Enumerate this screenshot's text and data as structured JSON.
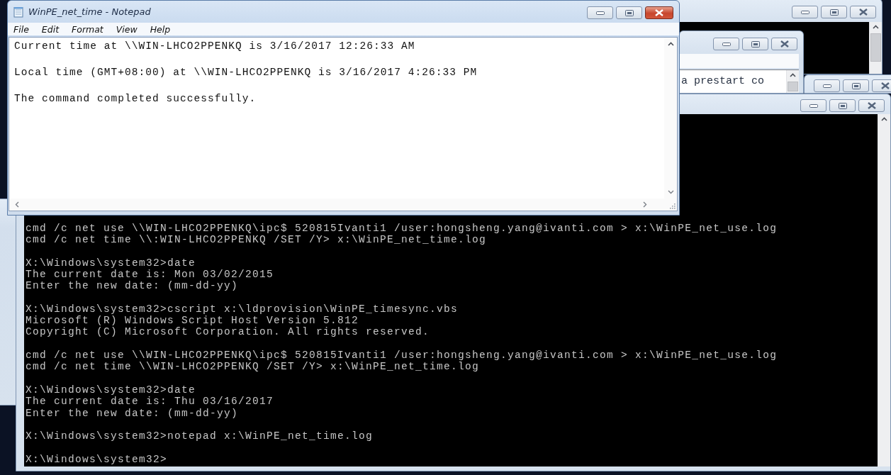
{
  "notepad": {
    "title": "WinPE_net_time - Notepad",
    "active": true,
    "menu": [
      "File",
      "Edit",
      "Format",
      "View",
      "Help"
    ],
    "lines": [
      "Current time at \\\\WIN-LHCO2PPENKQ is 3/16/2017 12:26:33 AM",
      "Local time (GMT+08:00) at \\\\WIN-LHCO2PPENKQ is 3/16/2017 4:26:33 PM",
      "The command completed successfully."
    ]
  },
  "background_editor": {
    "text": "a prestart co"
  },
  "console": {
    "blocks": [
      [
        "cmd /c net use \\\\WIN-LHCO2PPENKQ\\ipc$ 520815Ivanti1 /user:hongsheng.yang@ivanti.com > x:\\WinPE_net_use.log",
        "cmd /c net time \\\\:WIN-LHCO2PPENKQ /SET /Y> x:\\WinPE_net_time.log"
      ],
      [
        "X:\\Windows\\system32>date",
        "The current date is: Mon 03/02/2015",
        "Enter the new date: (mm-dd-yy)"
      ],
      [
        "X:\\Windows\\system32>cscript x:\\ldprovision\\WinPE_timesync.vbs",
        "Microsoft (R) Windows Script Host Version 5.812",
        "Copyright (C) Microsoft Corporation. All rights reserved."
      ],
      [
        "cmd /c net use \\\\WIN-LHCO2PPENKQ\\ipc$ 520815Ivanti1 /user:hongsheng.yang@ivanti.com > x:\\WinPE_net_use.log",
        "cmd /c net time \\\\WIN-LHCO2PPENKQ /SET /Y> x:\\WinPE_net_time.log"
      ],
      [
        "X:\\Windows\\system32>date",
        "The current date is: Thu 03/16/2017",
        "Enter the new date: (mm-dd-yy)"
      ],
      [
        "X:\\Windows\\system32>notepad x:\\WinPE_net_time.log"
      ],
      [
        "X:\\Windows\\system32>"
      ]
    ]
  }
}
